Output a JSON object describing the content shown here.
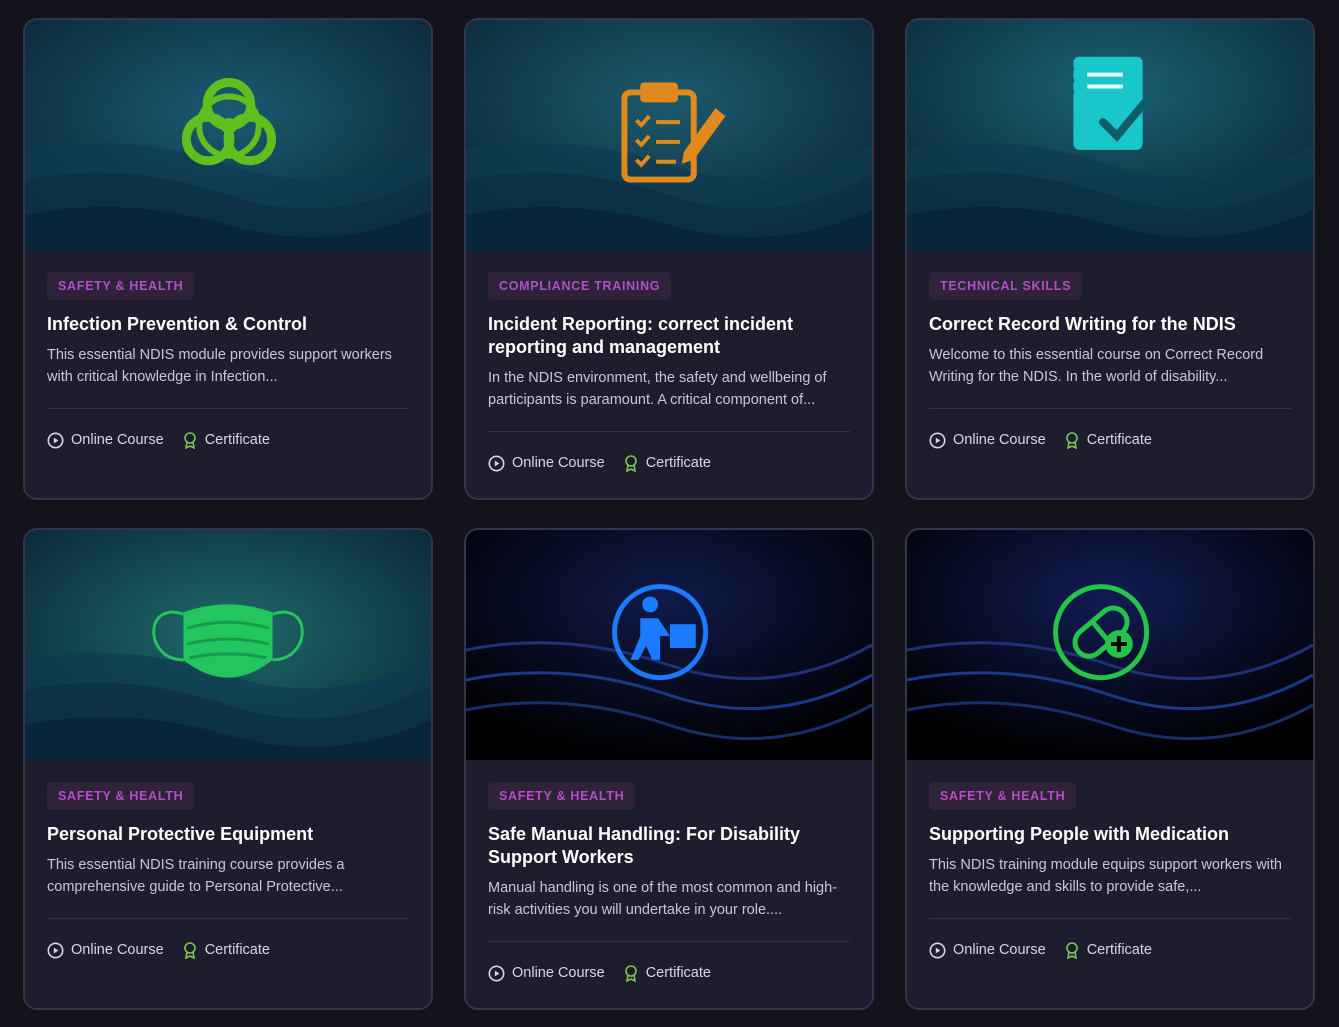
{
  "courses": [
    {
      "category": "SAFETY & HEALTH",
      "title": "Infection Prevention & Control",
      "description": "This essential NDIS module provides support workers with critical knowledge in Infection...",
      "format": "Online Course",
      "credential": "Certificate",
      "icon": "biohazard-icon",
      "icon_color": "#5fbf1f"
    },
    {
      "category": "COMPLIANCE TRAINING",
      "title": "Incident Reporting: correct incident reporting and management",
      "description": "In the NDIS environment, the safety and wellbeing of participants is paramount. A critical component of...",
      "format": "Online Course",
      "credential": "Certificate",
      "icon": "clipboard-checklist-icon",
      "icon_color": "#e08a1e"
    },
    {
      "category": "TECHNICAL SKILLS",
      "title": "Correct Record Writing for the NDIS",
      "description": "Welcome to this essential course on Correct Record Writing for the NDIS. In the world of disability...",
      "format": "Online Course",
      "credential": "Certificate",
      "icon": "notebook-check-icon",
      "icon_color": "#19c6c9"
    },
    {
      "category": "SAFETY & HEALTH",
      "title": "Personal Protective Equipment",
      "description": "This essential NDIS training course provides a comprehensive guide to Personal Protective...",
      "format": "Online Course",
      "credential": "Certificate",
      "icon": "face-mask-icon",
      "icon_color": "#22c55e"
    },
    {
      "category": "SAFETY & HEALTH",
      "title": "Safe Manual Handling: For Disability Support Workers",
      "description": "Manual handling is one of the most common and high-risk activities you will undertake in your role....",
      "format": "Online Course",
      "credential": "Certificate",
      "icon": "person-lifting-box-icon",
      "icon_color": "#1a7bff"
    },
    {
      "category": "SAFETY & HEALTH",
      "title": "Supporting People with Medication",
      "description": "This NDIS training module equips support workers with the knowledge and skills to provide safe,...",
      "format": "Online Course",
      "credential": "Certificate",
      "icon": "pill-plus-icon",
      "icon_color": "#22c548"
    }
  ],
  "colors": {
    "page_bg": "#13131c",
    "card_bg": "#1d1d2d",
    "tag_text": "#b44ec8",
    "certificate_icon": "#7ac74f"
  }
}
